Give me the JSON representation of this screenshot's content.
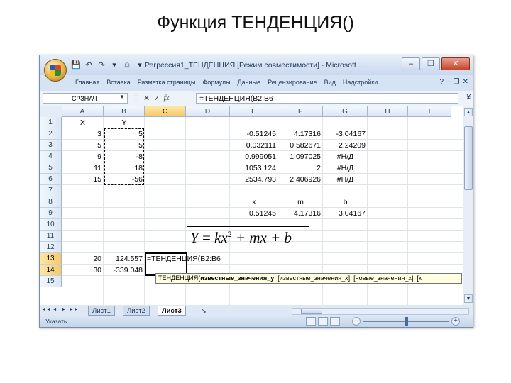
{
  "slide": {
    "title": "Функция ТЕНДЕНЦИЯ()"
  },
  "window": {
    "title": "Регрессия1_ТЕНДЕНЦИЯ  [Режим совместимости] - Microsoft ...",
    "qat": [
      "💾",
      "↶",
      "↷",
      "▾",
      "☺",
      "▾"
    ],
    "controls": {
      "minimize": "–",
      "restore": "❐",
      "close": "✕"
    }
  },
  "ribbon": {
    "tabs": [
      "Главная",
      "Вставка",
      "Разметка страницы",
      "Формулы",
      "Данные",
      "Рецензирование",
      "Вид",
      "Надстройки"
    ],
    "help": "?",
    "minimize": "–",
    "restore": "❐",
    "close": "✕"
  },
  "formula_bar": {
    "name_box": "СРЗНАЧ",
    "name_dropdown": "▼",
    "icons": [
      "⋮",
      "✕",
      "✓",
      "fx"
    ],
    "formula": "=ТЕНДЕНЦИЯ(B2:B6",
    "expand": "¥"
  },
  "columns": [
    "A",
    "B",
    "C",
    "D",
    "E",
    "F",
    "G",
    "H",
    "I"
  ],
  "active_column": "C",
  "rows": [
    "1",
    "2",
    "3",
    "4",
    "5",
    "6",
    "7",
    "8",
    "9",
    "10",
    "11",
    "12",
    "13",
    "14",
    "15"
  ],
  "active_rows": [
    "13",
    "14"
  ],
  "cells": {
    "A1": "X",
    "B1": "Y",
    "A2": "3",
    "B2": "5",
    "A3": "5",
    "B3": "5",
    "A4": "9",
    "B4": "-8",
    "A5": "11",
    "B5": "18",
    "A6": "15",
    "B6": "-56",
    "E2": "-0.51245",
    "F2": "4.17316",
    "G2": "-3.04167",
    "E3": "0.032111",
    "F3": "0.582671",
    "G3": "2.24209",
    "E4": "0.999051",
    "F4": "1.097025",
    "G4": "#Н/Д",
    "E5": "1053.124",
    "F5": "2",
    "G5": "#Н/Д",
    "E6": "2534.793",
    "F6": "2.406926",
    "G6": "#Н/Д",
    "E8": "k",
    "F8": "m",
    "G8": "b",
    "E9": "0.51245",
    "F9": "4.17316",
    "G9": "3.04167",
    "A13": "20",
    "B13": "124.557",
    "C13": "=ТЕНДЕНЦИЯ(B2:B6",
    "A14": "30",
    "B14": "-339.048"
  },
  "equation": {
    "y": "Y",
    "eq": " = ",
    "kx": "kx",
    "sup": "2",
    "rest": " + mx + b"
  },
  "tooltip": {
    "func": "ТЕНДЕНЦИЯ(",
    "arg1": "известные_значения_y",
    "rest": "; [известные_значения_x]; [новые_значения_x]; [к"
  },
  "sheets": {
    "tabs": [
      "Лист1",
      "Лист2",
      "Лист3"
    ],
    "active": "Лист3",
    "nav": [
      "◄◄",
      "◄",
      "►",
      "►►"
    ],
    "add": "↘"
  },
  "status": {
    "mode": "Указать"
  },
  "scroll": {
    "up": "▲",
    "down": "▼"
  },
  "zoom": {
    "minus": "–",
    "plus": "+"
  }
}
